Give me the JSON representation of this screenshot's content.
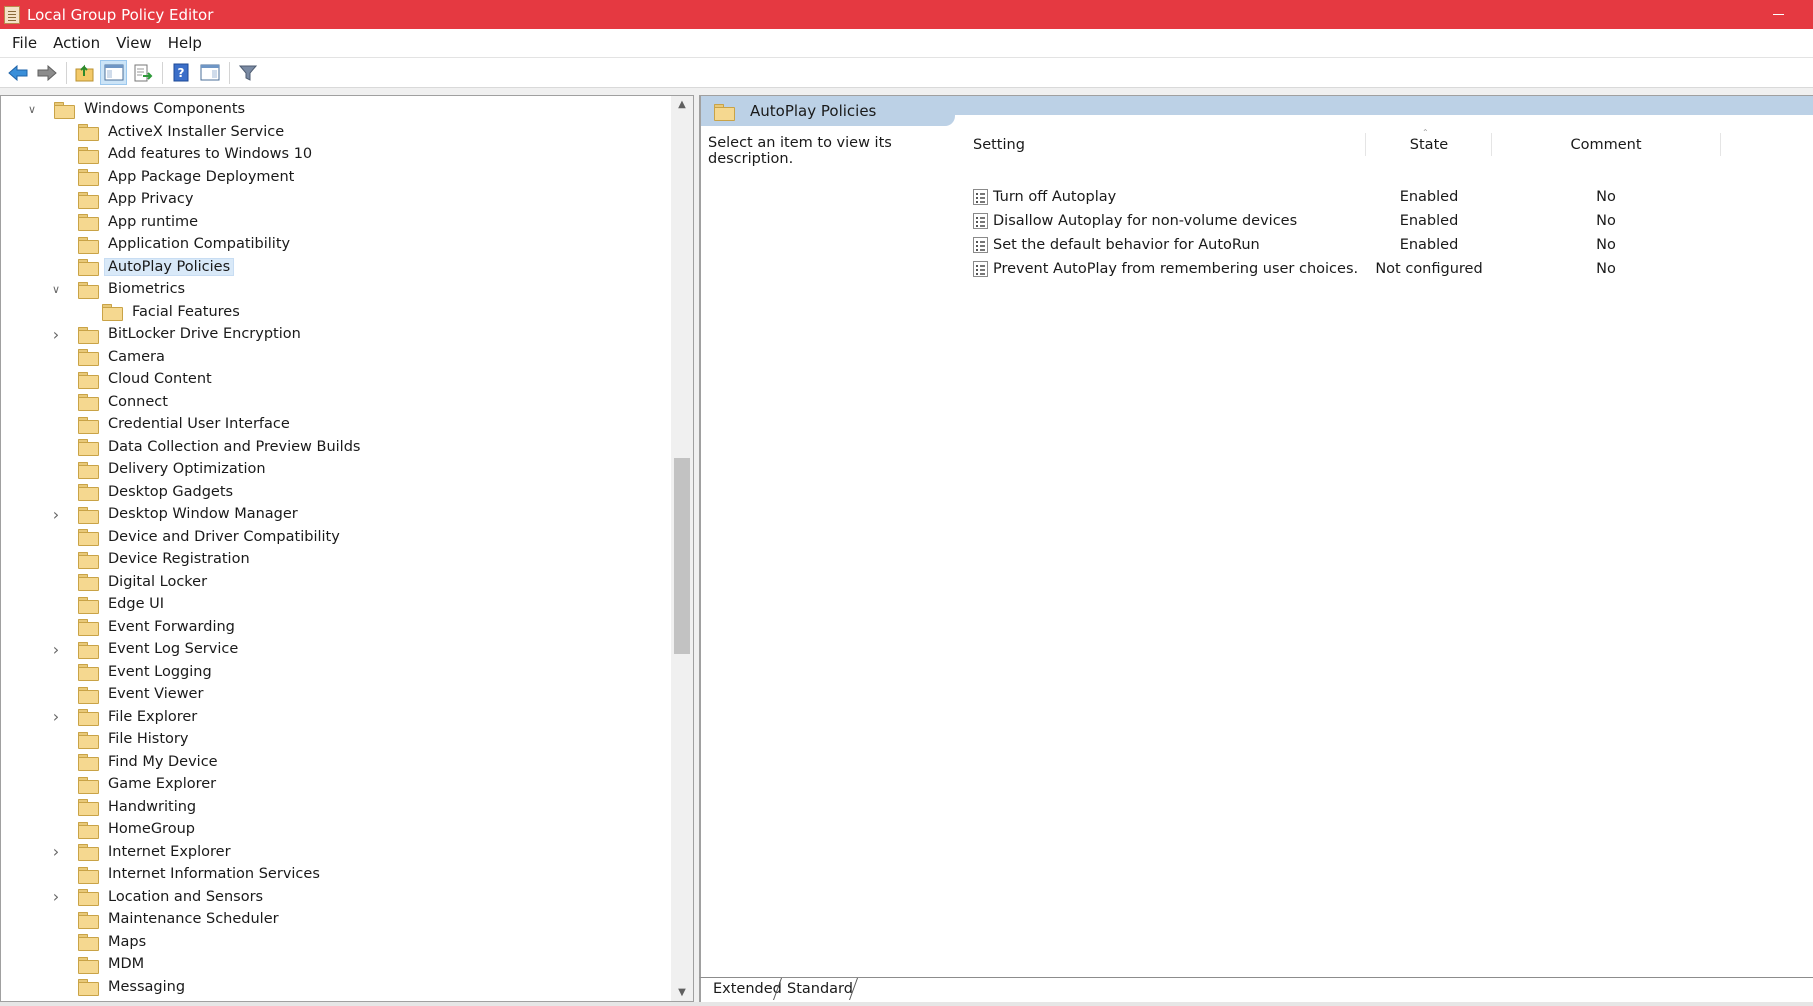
{
  "window": {
    "title": "Local Group Policy Editor"
  },
  "menu": {
    "items": [
      "File",
      "Action",
      "View",
      "Help"
    ]
  },
  "toolbar": {
    "buttons": [
      "back-arrow-icon",
      "forward-arrow-icon",
      "up-folder-icon",
      "show-hide-console-tree-icon",
      "export-list-icon",
      "help-icon",
      "show-hide-action-pane-icon",
      "filter-icon"
    ]
  },
  "tree": {
    "items": [
      {
        "label": "Windows Components",
        "expander": "expanded"
      },
      {
        "label": "ActiveX Installer Service",
        "expander": ""
      },
      {
        "label": "Add features to Windows 10",
        "expander": ""
      },
      {
        "label": "App Package Deployment",
        "expander": ""
      },
      {
        "label": "App Privacy",
        "expander": ""
      },
      {
        "label": "App runtime",
        "expander": ""
      },
      {
        "label": "Application Compatibility",
        "expander": ""
      },
      {
        "label": "AutoPlay Policies",
        "expander": "",
        "selected": true
      },
      {
        "label": "Biometrics",
        "expander": "expanded"
      },
      {
        "label": "Facial Features",
        "expander": ""
      },
      {
        "label": "BitLocker Drive Encryption",
        "expander": "collapsed"
      },
      {
        "label": "Camera",
        "expander": ""
      },
      {
        "label": "Cloud Content",
        "expander": ""
      },
      {
        "label": "Connect",
        "expander": ""
      },
      {
        "label": "Credential User Interface",
        "expander": ""
      },
      {
        "label": "Data Collection and Preview Builds",
        "expander": ""
      },
      {
        "label": "Delivery Optimization",
        "expander": ""
      },
      {
        "label": "Desktop Gadgets",
        "expander": ""
      },
      {
        "label": "Desktop Window Manager",
        "expander": "collapsed"
      },
      {
        "label": "Device and Driver Compatibility",
        "expander": ""
      },
      {
        "label": "Device Registration",
        "expander": ""
      },
      {
        "label": "Digital Locker",
        "expander": ""
      },
      {
        "label": "Edge UI",
        "expander": ""
      },
      {
        "label": "Event Forwarding",
        "expander": ""
      },
      {
        "label": "Event Log Service",
        "expander": "collapsed"
      },
      {
        "label": "Event Logging",
        "expander": ""
      },
      {
        "label": "Event Viewer",
        "expander": ""
      },
      {
        "label": "File Explorer",
        "expander": "collapsed"
      },
      {
        "label": "File History",
        "expander": ""
      },
      {
        "label": "Find My Device",
        "expander": ""
      },
      {
        "label": "Game Explorer",
        "expander": ""
      },
      {
        "label": "Handwriting",
        "expander": ""
      },
      {
        "label": "HomeGroup",
        "expander": ""
      },
      {
        "label": "Internet Explorer",
        "expander": "collapsed"
      },
      {
        "label": "Internet Information Services",
        "expander": ""
      },
      {
        "label": "Location and Sensors",
        "expander": "collapsed"
      },
      {
        "label": "Maintenance Scheduler",
        "expander": ""
      },
      {
        "label": "Maps",
        "expander": ""
      },
      {
        "label": "MDM",
        "expander": ""
      },
      {
        "label": "Messaging",
        "expander": ""
      }
    ]
  },
  "details": {
    "folder_title": "AutoPlay Policies",
    "description": "Select an item to view its description.",
    "columns": {
      "setting": "Setting",
      "state": "State",
      "comment": "Comment"
    },
    "rows": [
      {
        "setting": "Turn off Autoplay",
        "state": "Enabled",
        "comment": "No"
      },
      {
        "setting": "Disallow Autoplay for non-volume devices",
        "state": "Enabled",
        "comment": "No"
      },
      {
        "setting": "Set the default behavior for AutoRun",
        "state": "Enabled",
        "comment": "No"
      },
      {
        "setting": "Prevent AutoPlay from remembering user choices.",
        "state": "Not configured",
        "comment": "No"
      }
    ]
  },
  "bottom_tabs": {
    "extended": "Extended",
    "standard": "Standard"
  },
  "colors": {
    "titlebar": "#e53941",
    "header_band": "#bcd1e6",
    "selection": "#d9e9f8"
  }
}
